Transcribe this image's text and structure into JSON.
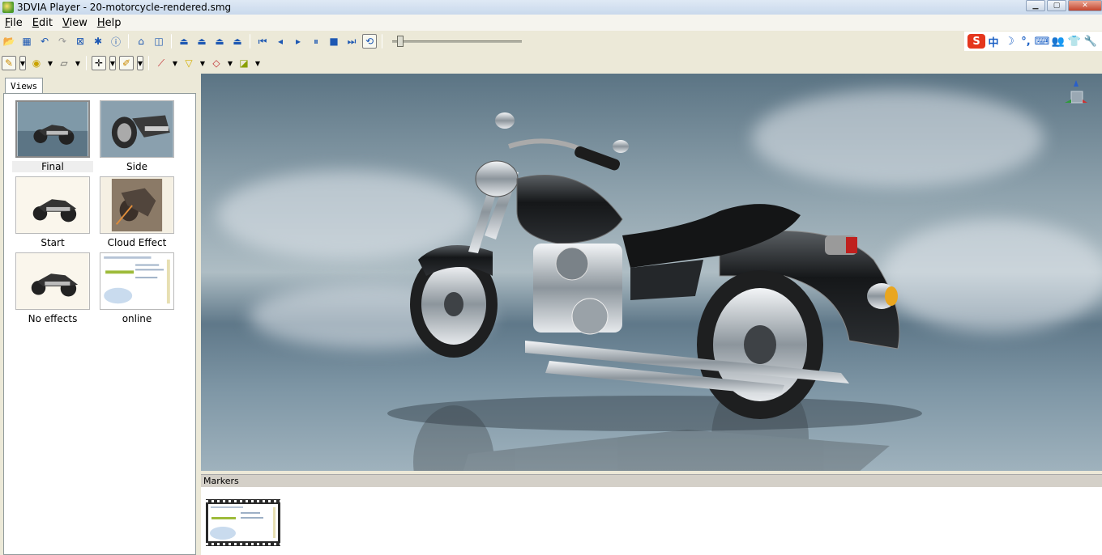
{
  "window": {
    "title": "3DVIA Player - 20-motorcycle-rendered.smg",
    "controls": [
      "minimize",
      "maximize",
      "close"
    ]
  },
  "menu": {
    "items": [
      "File",
      "Edit",
      "View",
      "Help"
    ]
  },
  "toolbar": {
    "row1": [
      "open-icon",
      "save-icon",
      "undo-icon",
      "redo-icon",
      "cross-section-icon",
      "properties-icon",
      "info-icon",
      "home-icon",
      "view-icon",
      "camera-a-icon",
      "camera-b-icon",
      "camera-c-icon",
      "camera-d-icon",
      "first-icon",
      "prev-icon",
      "play-icon",
      "pause-icon",
      "stop-icon",
      "next-icon",
      "loop-icon"
    ],
    "row2": [
      "render-mode-icon",
      "shading-icon",
      "layers-icon",
      "move-icon",
      "paint-icon",
      "measure-icon",
      "annotate-icon",
      "markup-icon",
      "publish-icon"
    ],
    "slider_position": 0.04
  },
  "tray": {
    "items": [
      "S",
      "中",
      "☽",
      "°,",
      "⌨",
      "👥",
      "👕",
      "🔧"
    ]
  },
  "views": {
    "tab_label": "Views",
    "items": [
      {
        "label": "Final",
        "selected": true
      },
      {
        "label": "Side",
        "selected": false
      },
      {
        "label": "Start",
        "selected": false
      },
      {
        "label": "Cloud Effect",
        "selected": false
      },
      {
        "label": "No effects",
        "selected": false
      },
      {
        "label": "online",
        "selected": false
      }
    ]
  },
  "markers": {
    "header": "Markers"
  },
  "colors": {
    "sky": "#7f97a6",
    "panel": "#ece9d8",
    "accent": "#1d58b3"
  }
}
